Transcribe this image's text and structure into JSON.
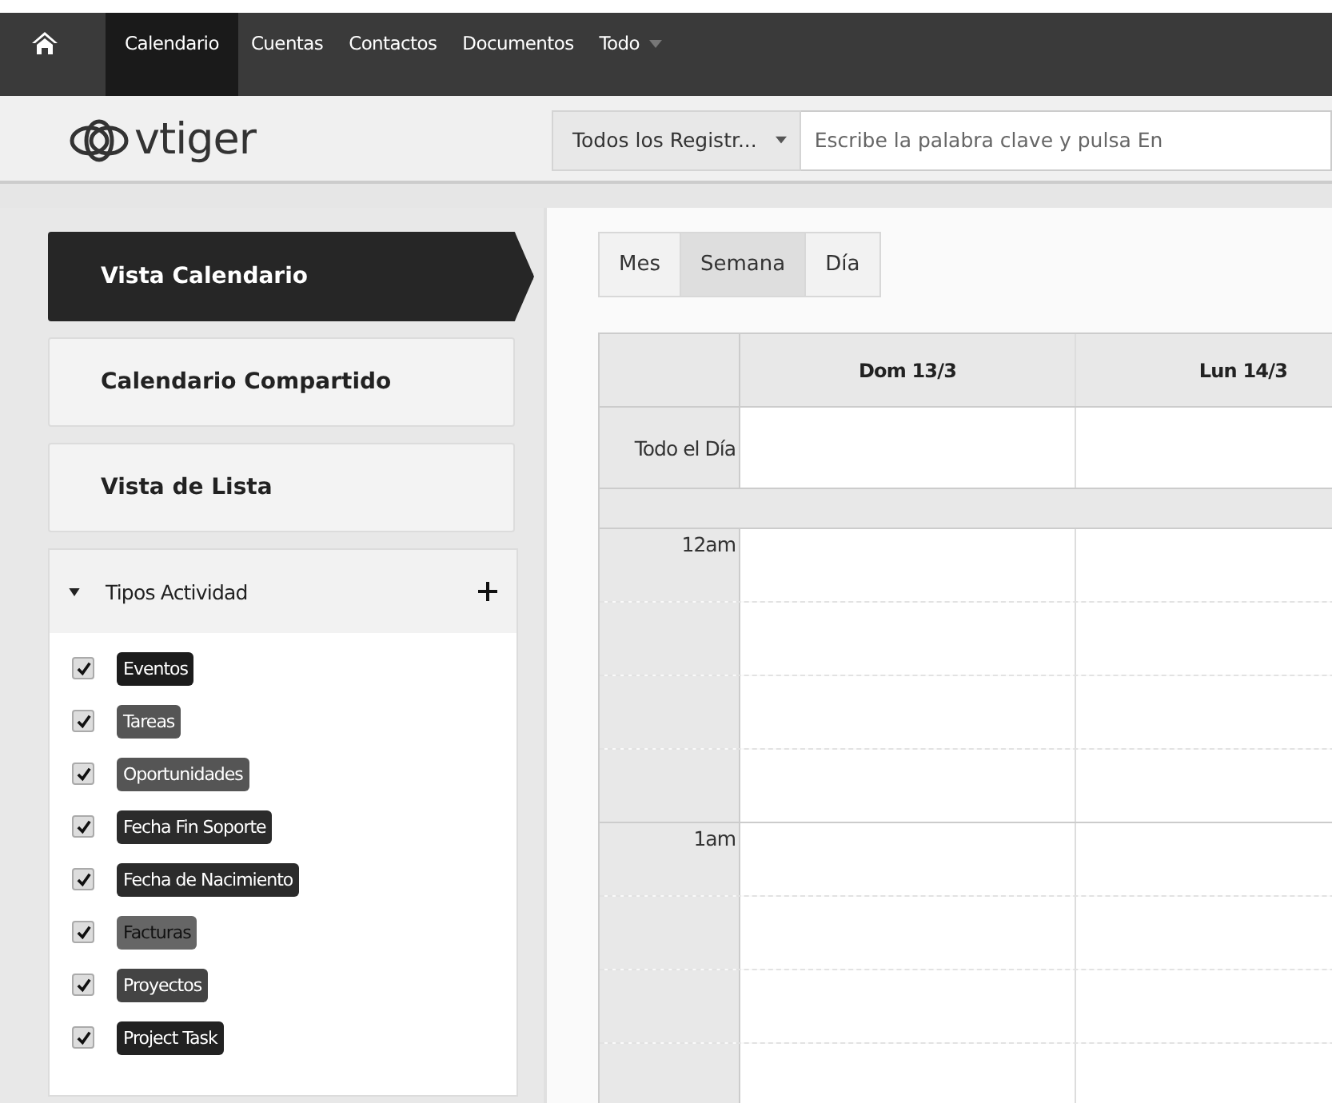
{
  "nav": {
    "items": [
      {
        "label": "Calendario",
        "selected": true
      },
      {
        "label": "Cuentas",
        "selected": false
      },
      {
        "label": "Contactos",
        "selected": false
      },
      {
        "label": "Documentos",
        "selected": false
      },
      {
        "label": "Todo",
        "selected": false,
        "dropdown": true
      }
    ]
  },
  "header": {
    "logo": "vtiger",
    "search_scope": "Todos los Registr...",
    "search": {
      "placeholder": "Escribe la palabra clave y pulsa En"
    }
  },
  "sidebar": {
    "views": [
      {
        "label": "Vista Calendario",
        "selected": true
      },
      {
        "label": "Calendario Compartido",
        "selected": false
      },
      {
        "label": "Vista de Lista",
        "selected": false
      }
    ],
    "activity_types": {
      "title": "Tipos Actividad",
      "expanded": true,
      "items": [
        {
          "label": "Eventos",
          "checked": true,
          "color": "#1c1c1c"
        },
        {
          "label": "Tareas",
          "checked": true,
          "color": "#555555"
        },
        {
          "label": "Oportunidades",
          "checked": true,
          "color": "#555555"
        },
        {
          "label": "Fecha Fin Soporte",
          "checked": true,
          "color": "#2b2b2b"
        },
        {
          "label": "Fecha de Nacimiento",
          "checked": true,
          "color": "#2b2b2b"
        },
        {
          "label": "Facturas",
          "checked": true,
          "color": "#666666"
        },
        {
          "label": "Proyectos",
          "checked": true,
          "color": "#444444"
        },
        {
          "label": "Project Task",
          "checked": true,
          "color": "#222222"
        }
      ]
    }
  },
  "calendar": {
    "view_tabs": [
      {
        "label": "Mes",
        "selected": false
      },
      {
        "label": "Semana",
        "selected": true
      },
      {
        "label": "Día",
        "selected": false
      }
    ],
    "columns": [
      "Dom 13/3",
      "Lun 14/3"
    ],
    "all_day_label": "Todo el Día",
    "hours": [
      {
        "label": "12am"
      },
      {
        "label": "1am"
      }
    ]
  }
}
